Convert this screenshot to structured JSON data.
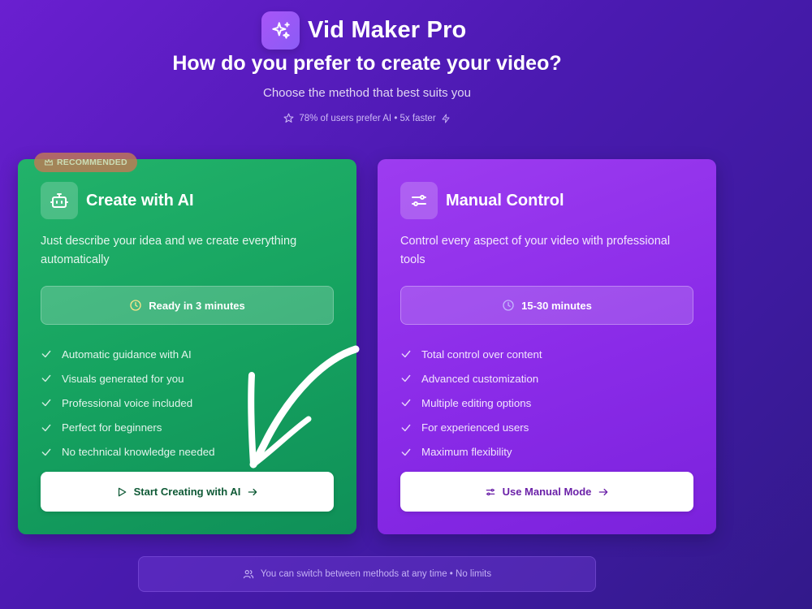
{
  "brand": {
    "name": "Vid Maker Pro",
    "icon": "sparkles-icon"
  },
  "headline": "How do you prefer to create your video?",
  "subline": "Choose the method that best suits you",
  "stat": {
    "text": "78% of users prefer AI • 5x faster",
    "left_icon": "star-icon",
    "right_icon": "zap-icon"
  },
  "ai_card": {
    "badge": "RECOMMENDED",
    "badge_icon": "crown-icon",
    "icon": "bot-icon",
    "title": "Create with AI",
    "description": "Just describe your idea and we create everything automatically",
    "time": "Ready in 3 minutes",
    "features": [
      "Automatic guidance with AI",
      "Visuals generated for you",
      "Professional voice included",
      "Perfect for beginners",
      "No technical knowledge needed"
    ],
    "cta": "Start Creating with AI",
    "color": "#16a360"
  },
  "manual_card": {
    "icon": "sliders-icon",
    "title": "Manual Control",
    "description": "Control every aspect of your video with professional tools",
    "time": "15-30 minutes",
    "features": [
      "Total control over content",
      "Advanced customization",
      "Multiple editing options",
      "For experienced users",
      "Maximum flexibility"
    ],
    "cta": "Use Manual Mode",
    "color": "#8a2be8"
  },
  "footer": {
    "text": "You can switch between methods at any time • No limits",
    "icon": "users-icon"
  },
  "colors": {
    "background": "#4a1ab0",
    "accent_green": "#16a360",
    "accent_purple": "#8a2be8",
    "clock_ai": "#fde68a",
    "clock_manual": "#c4b5fd"
  }
}
